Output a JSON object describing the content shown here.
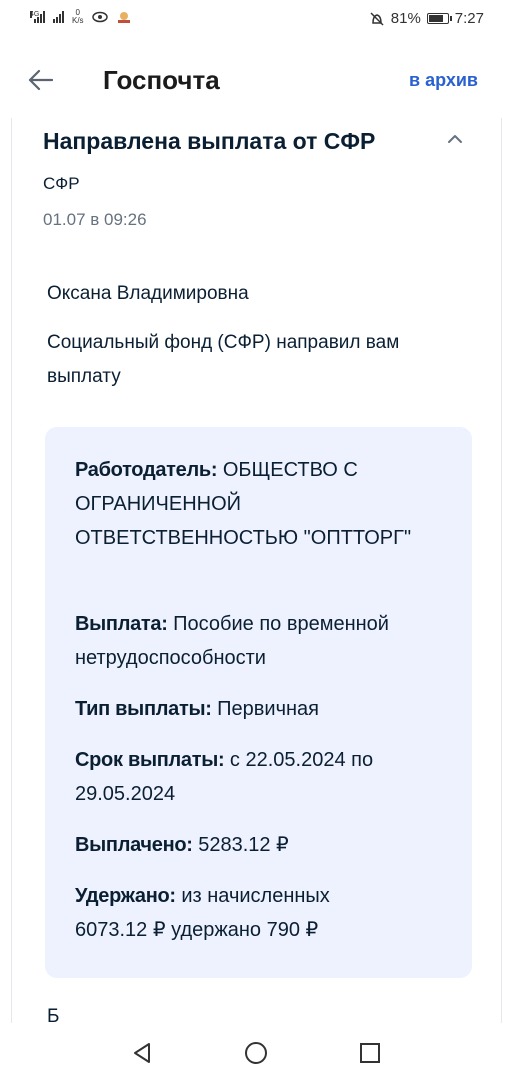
{
  "status_bar": {
    "signal_tag": "4G",
    "net_speed_value": "0",
    "net_speed_unit": "K/s",
    "battery": "81%",
    "battery_level": 0.81,
    "time": "7:27"
  },
  "header": {
    "title": "Госпочта",
    "archive_label": "в архив"
  },
  "message": {
    "title": "Направлена выплата от СФР",
    "sender": "СФР",
    "date": "01.07 в 09:26",
    "greeting": "Оксана Владимировна",
    "intro": "Социальный фонд (СФР) направил вам выплату",
    "details": [
      {
        "label": "Работодатель:",
        "value": " ОБЩЕСТВО С ОГРАНИЧЕННОЙ ОТВЕТСТВЕННОСТЬЮ \"ОПТТОРГ\""
      },
      {
        "label": "Выплата:",
        "value": " Пособие по временной нетрудоспособности"
      },
      {
        "label": "Тип выплаты:",
        "value": " Первичная"
      },
      {
        "label": "Срок выплаты:",
        "value": " с 22.05.2024 по 29.05.2024"
      },
      {
        "label": "Выплачено:",
        "value": " 5283.12 ₽"
      },
      {
        "label": "Удержано:",
        "value": " из начисленных 6073.12 ₽ удержано 790 ₽"
      }
    ],
    "trailing_text": "Б"
  },
  "colors": {
    "accent": "#2a61d1",
    "info_box_bg": "#edf2fe",
    "text": "#0b1f33",
    "muted": "#66727f"
  },
  "icons": [
    "back-arrow-icon",
    "chevron-up-icon",
    "nav-back-icon",
    "nav-home-icon",
    "nav-recents-icon"
  ]
}
